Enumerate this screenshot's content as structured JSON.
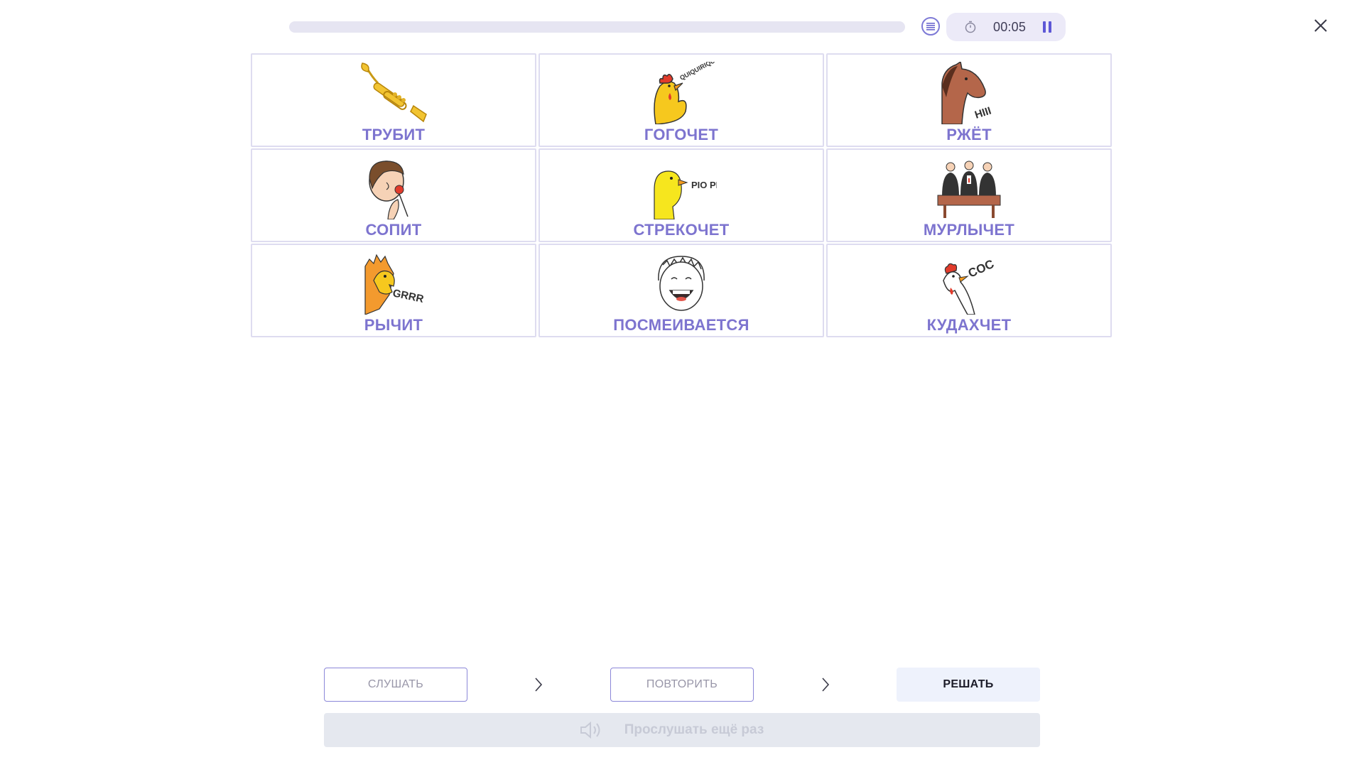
{
  "header": {
    "progress": 0,
    "timer": "00:05",
    "icons": {
      "list": "list-icon",
      "stopwatch": "stopwatch-icon",
      "pause": "pause-icon",
      "close": "close-icon"
    }
  },
  "cards": [
    {
      "label": "ТРУБИТ",
      "icon": "trumpet-icon"
    },
    {
      "label": "ГОГОЧЕТ",
      "icon": "rooster-icon",
      "sound": "QUIQUIRIQUI"
    },
    {
      "label": "РЖЁТ",
      "icon": "horse-icon",
      "sound": "HIII"
    },
    {
      "label": "СОПИТ",
      "icon": "boy-smelling-flower-icon"
    },
    {
      "label": "СТРЕКОЧЕТ",
      "icon": "chick-icon",
      "sound": "PIO PIO"
    },
    {
      "label": "МУРЛЫЧЕТ",
      "icon": "funeral-icon"
    },
    {
      "label": "РЫЧИТ",
      "icon": "lion-icon",
      "sound": "GRRR"
    },
    {
      "label": "ПОСМЕИВАЕТСЯ",
      "icon": "laughing-boy-icon"
    },
    {
      "label": "КУДАХЧЕТ",
      "icon": "hen-icon",
      "sound": "COC"
    }
  ],
  "steps": {
    "listen": "СЛУШАТЬ",
    "repeat": "ПОВТОРИТЬ",
    "solve": "РЕШАТЬ"
  },
  "replay": {
    "label": "Прослушать ещё раз",
    "icon": "speaker-icon"
  },
  "colors": {
    "accent": "#7d74cf",
    "card_border": "#dedcf0",
    "progress_track": "#e6e5f2"
  }
}
